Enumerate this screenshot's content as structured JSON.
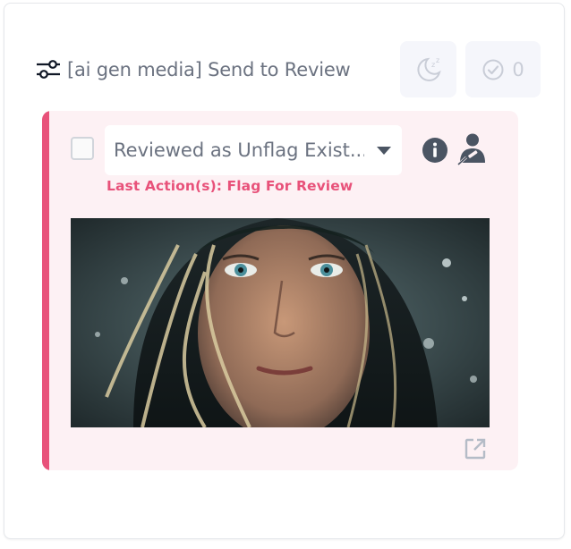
{
  "header": {
    "title": "[ai gen media] Send to Review",
    "filter_icon": "sliders-icon",
    "snooze_icon": "moon-snooze-icon",
    "approve_icon": "check-circle-icon",
    "approve_count": "0"
  },
  "card": {
    "accent_color": "#e8527a",
    "background_color": "#fdf1f4",
    "status_select": {
      "value": "Reviewed as Unflag Exist..."
    },
    "info_icon": "info-circle-icon",
    "moderator_icon": "user-gavel-icon",
    "last_action": "Last Action(s): Flag For Review",
    "media_alt": "media-thumbnail",
    "open_icon": "external-link-icon"
  }
}
